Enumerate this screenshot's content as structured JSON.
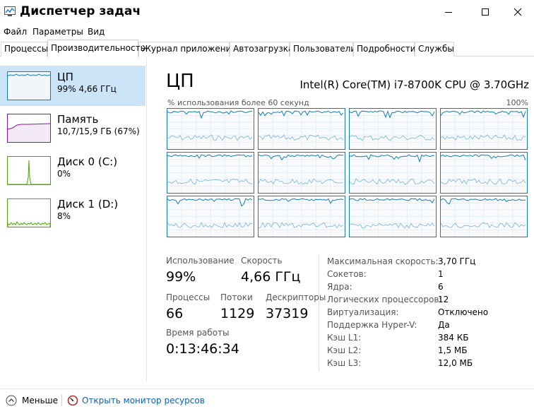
{
  "window": {
    "title": "Диспетчер задач",
    "controls": {
      "minimize": "—",
      "maximize": "☐",
      "close": "✕"
    }
  },
  "menu": [
    "Файл",
    "Параметры",
    "Вид"
  ],
  "tabs": [
    "Процессы",
    "Производительность",
    "Журнал приложений",
    "Автозагрузка",
    "Пользователи",
    "Подробности",
    "Службы"
  ],
  "active_tab": "Производительность",
  "sidebar": {
    "items": [
      {
        "title": "ЦП",
        "sub": "99% 4,66 ГГц",
        "color": "#117dbb",
        "fill": "#f1f6fa",
        "selected": true
      },
      {
        "title": "Память",
        "sub": "10,7/15,9 ГБ (67%)",
        "color": "#8b12ae",
        "fill": "#f4eaf7",
        "selected": false
      },
      {
        "title": "Диск 0 (C:)",
        "sub": "0%",
        "color": "#4da60c",
        "fill": "#eff7e7",
        "selected": false
      },
      {
        "title": "Диск 1 (D:)",
        "sub": "8%",
        "color": "#4da60c",
        "fill": "#eff7e7",
        "selected": false
      }
    ]
  },
  "main": {
    "title": "ЦП",
    "cpu_name": "Intel(R) Core(TM) i7-8700K CPU @ 3.70GHz",
    "util_label": "% использования более 60 секунд",
    "util_max": "100%",
    "logical_cores": 12,
    "graph_color": "#117dbb",
    "graph_fill": "#f1f6fa"
  },
  "stats": {
    "usage_label": "Использование",
    "usage_value": "99%",
    "speed_label": "Скорость",
    "speed_value": "4,66 ГГц",
    "processes_label": "Процессы",
    "processes_value": "66",
    "threads_label": "Потоки",
    "threads_value": "1129",
    "handles_label": "Дескрипторы",
    "handles_value": "37319",
    "uptime_label": "Время работы",
    "uptime_value": "0:13:46:34"
  },
  "specs": [
    {
      "label": "Максимальная скорость:",
      "value": "3,70 ГГц"
    },
    {
      "label": "Сокетов:",
      "value": "1"
    },
    {
      "label": "Ядра:",
      "value": "6"
    },
    {
      "label": "Логических процессоров:",
      "value": "12"
    },
    {
      "label": "Виртуализация:",
      "value": "Отключено"
    },
    {
      "label": "Поддержка Hyper-V:",
      "value": "Да"
    },
    {
      "label": "Кэш L1:",
      "value": "384 КБ"
    },
    {
      "label": "Кэш L2:",
      "value": "1,5 МБ"
    },
    {
      "label": "Кэш L3:",
      "value": "12,0 МБ"
    }
  ],
  "footer": {
    "fewer_label": "Меньше",
    "monitor_link": "Открыть монитор ресурсов"
  }
}
